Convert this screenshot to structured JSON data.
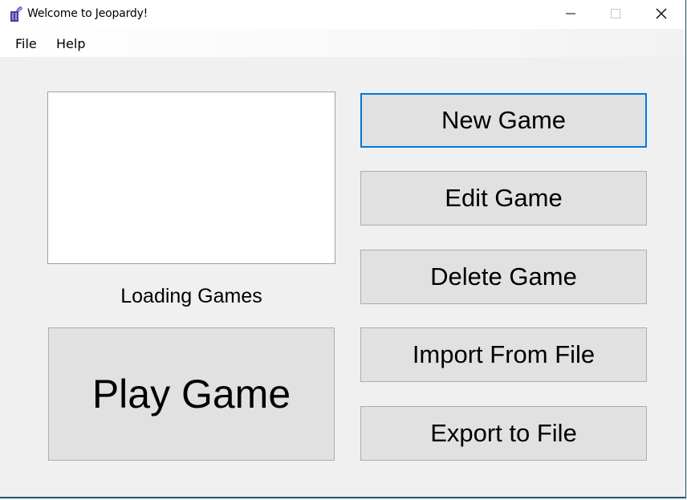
{
  "window": {
    "title": "Welcome to Jeopardy!",
    "controls": [
      "minimize-icon",
      "maximize-icon",
      "close-icon"
    ]
  },
  "menu": {
    "items": [
      {
        "label": "File"
      },
      {
        "label": "Help"
      }
    ]
  },
  "games_list": {
    "items": []
  },
  "status": {
    "text": "Loading Games"
  },
  "buttons": {
    "play_game": "Play Game",
    "new_game": "New Game",
    "edit_game": "Edit Game",
    "delete_game": "Delete Game",
    "import_from_file": "Import From File",
    "export_to_file": "Export to File"
  },
  "colors": {
    "focus_border": "#0078d7",
    "button_face": "#e1e1e1",
    "window_border": "#1f5a6e"
  }
}
